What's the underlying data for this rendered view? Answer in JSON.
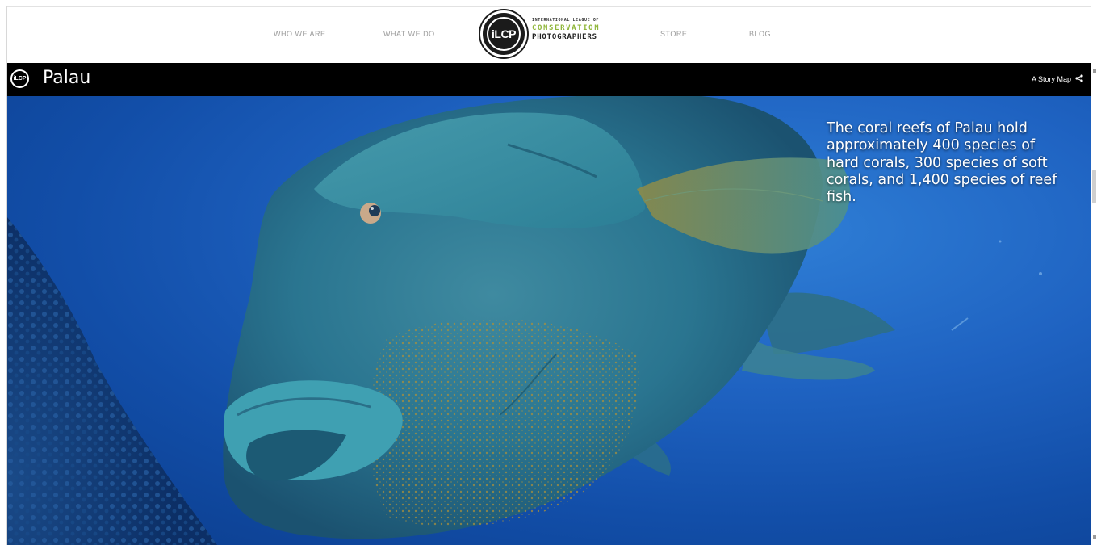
{
  "header": {
    "nav": [
      {
        "label": "WHO WE ARE"
      },
      {
        "label": "WHAT WE DO"
      },
      {
        "label": "STORE"
      },
      {
        "label": "BLOG"
      }
    ],
    "logo": {
      "mark": "iLCP",
      "line1": "INTERNATIONAL LEAGUE OF",
      "line2": "CONSERVATION",
      "line3": "PHOTOGRAPHERS"
    }
  },
  "story_bar": {
    "logo_mark": "iLCP",
    "title": "Palau",
    "right_label": "A Story Map",
    "share_icon": "share-icon"
  },
  "hero": {
    "caption": "The coral reefs of Palau hold approximately 400 species of hard corals, 300 species of soft corals, and 1,400 species of reef fish.",
    "subject": "humphead-wrasse-photo"
  },
  "colors": {
    "accent_green": "#8fb63a",
    "bar_black": "#000000",
    "ocean_blue": "#1f63c2"
  }
}
